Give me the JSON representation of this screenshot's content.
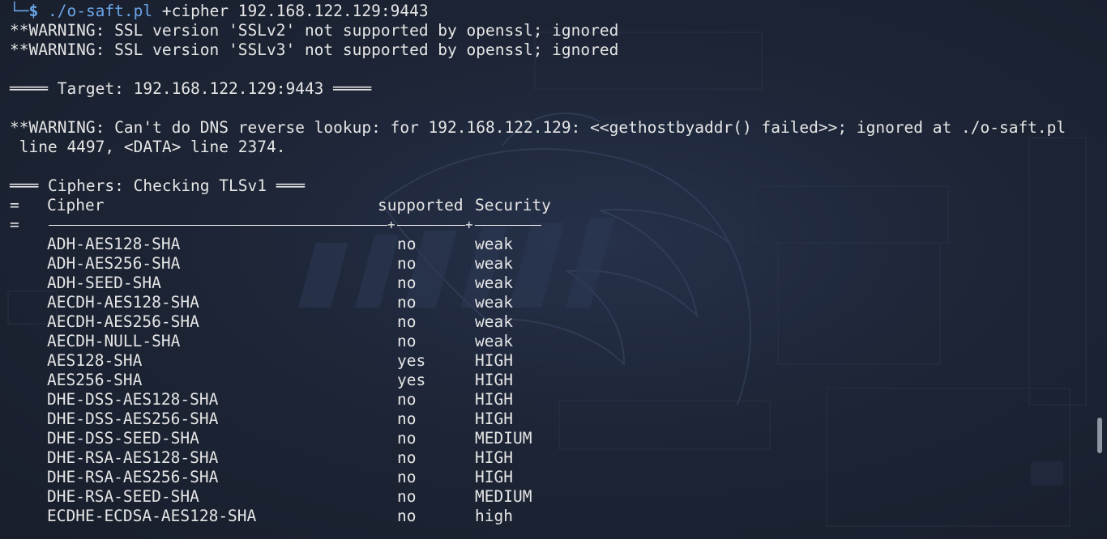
{
  "terminal": {
    "prompt_corner": "└─",
    "prompt_symbol": "$",
    "command_path": "./o-saft.pl",
    "command_args": " +cipher 192.168.122.129:9443",
    "warnings_ssl": [
      "**WARNING: SSL version 'SSLv2' not supported by openssl; ignored",
      "**WARNING: SSL version 'SSLv3' not supported by openssl; ignored"
    ],
    "target_header": "════ Target: 192.168.122.129:9443 ════",
    "dns_warning_line1": "**WARNING: Can't do DNS reverse lookup: for 192.168.122.129: <<gethostbyaddr() failed>>; ignored at ./o-saft.pl",
    "dns_warning_line2": " line 4497, <DATA> line 2374.",
    "ciphers_header": "═══ Ciphers: Checking TLSv1 ═══",
    "table": {
      "prefix_header": "=",
      "prefix_separator": "=",
      "col_cipher": "Cipher",
      "col_supported": "supported",
      "col_security": "Security",
      "rows": [
        {
          "cipher": "ADH-AES128-SHA",
          "supported": "no",
          "security": "weak"
        },
        {
          "cipher": "ADH-AES256-SHA",
          "supported": "no",
          "security": "weak"
        },
        {
          "cipher": "ADH-SEED-SHA",
          "supported": "no",
          "security": "weak"
        },
        {
          "cipher": "AECDH-AES128-SHA",
          "supported": "no",
          "security": "weak"
        },
        {
          "cipher": "AECDH-AES256-SHA",
          "supported": "no",
          "security": "weak"
        },
        {
          "cipher": "AECDH-NULL-SHA",
          "supported": "no",
          "security": "weak"
        },
        {
          "cipher": "AES128-SHA",
          "supported": "yes",
          "security": "HIGH"
        },
        {
          "cipher": "AES256-SHA",
          "supported": "yes",
          "security": "HIGH"
        },
        {
          "cipher": "DHE-DSS-AES128-SHA",
          "supported": "no",
          "security": "HIGH"
        },
        {
          "cipher": "DHE-DSS-AES256-SHA",
          "supported": "no",
          "security": "HIGH"
        },
        {
          "cipher": "DHE-DSS-SEED-SHA",
          "supported": "no",
          "security": "MEDIUM"
        },
        {
          "cipher": "DHE-RSA-AES128-SHA",
          "supported": "no",
          "security": "HIGH"
        },
        {
          "cipher": "DHE-RSA-AES256-SHA",
          "supported": "no",
          "security": "HIGH"
        },
        {
          "cipher": "DHE-RSA-SEED-SHA",
          "supported": "no",
          "security": "MEDIUM"
        },
        {
          "cipher": "ECDHE-ECDSA-AES128-SHA",
          "supported": "no",
          "security": "high"
        }
      ]
    }
  },
  "colors": {
    "background": "#1c2330",
    "text": "#e6e6e6",
    "prompt_accent": "#6aa6e8"
  }
}
